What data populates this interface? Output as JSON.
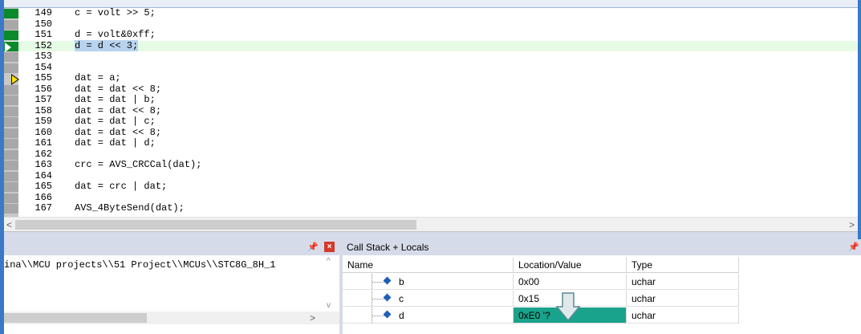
{
  "editor": {
    "lines": [
      {
        "num": "149",
        "code": "c = volt >> 5;",
        "marker": "green"
      },
      {
        "num": "150",
        "code": "",
        "marker": "gray"
      },
      {
        "num": "151",
        "code": "d = volt&0xff;",
        "marker": "green"
      },
      {
        "num": "152",
        "code": "d = d << 3;",
        "marker": "green-arrow",
        "current": true
      },
      {
        "num": "153",
        "code": "",
        "marker": "gray"
      },
      {
        "num": "154",
        "code": "",
        "marker": "gray"
      },
      {
        "num": "155",
        "code": "dat = a;",
        "marker": "yellow-arrow"
      },
      {
        "num": "156",
        "code": "dat = dat << 8;",
        "marker": "gray"
      },
      {
        "num": "157",
        "code": "dat = dat | b;",
        "marker": "gray"
      },
      {
        "num": "158",
        "code": "dat = dat << 8;",
        "marker": "gray"
      },
      {
        "num": "159",
        "code": "dat = dat | c;",
        "marker": "gray"
      },
      {
        "num": "160",
        "code": "dat = dat << 8;",
        "marker": "gray"
      },
      {
        "num": "161",
        "code": "dat = dat | d;",
        "marker": "gray"
      },
      {
        "num": "162",
        "code": "",
        "marker": "gray"
      },
      {
        "num": "163",
        "code": "crc = AVS_CRCCal(dat);",
        "marker": "gray"
      },
      {
        "num": "164",
        "code": "",
        "marker": "gray"
      },
      {
        "num": "165",
        "code": "dat = crc | dat;",
        "marker": "gray"
      },
      {
        "num": "166",
        "code": "",
        "marker": "gray"
      },
      {
        "num": "167",
        "code": "AVS_4ByteSend(dat);",
        "marker": "gray"
      }
    ]
  },
  "build_output": {
    "text": "ina\\\\MCU projects\\\\51 Project\\\\MCUs\\\\STC8G_8H_1"
  },
  "callstack": {
    "title": "Call Stack + Locals",
    "headers": {
      "name": "Name",
      "value": "Location/Value",
      "type": "Type"
    },
    "rows": [
      {
        "name": "b",
        "value": "0x00",
        "type": "uchar"
      },
      {
        "name": "c",
        "value": "0x15",
        "type": "uchar"
      },
      {
        "name": "d",
        "value": "0xE0 '?",
        "type": "uchar",
        "highlight": true
      }
    ]
  },
  "colors": {
    "marker_green": "#0a8a2a",
    "highlight_teal": "#1aa38c",
    "selection": "#b9d3ee"
  }
}
